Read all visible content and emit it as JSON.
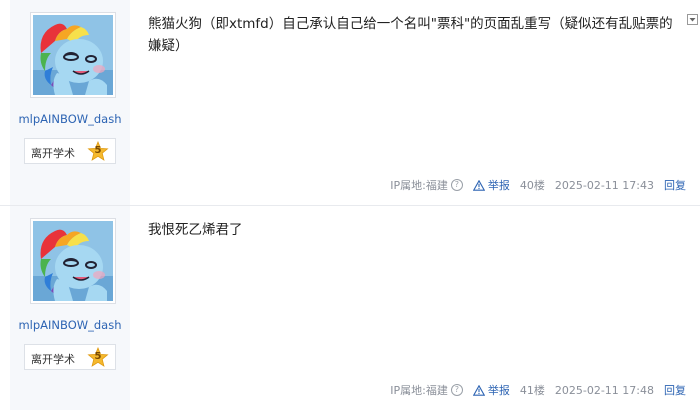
{
  "posts": [
    {
      "username": "mlpAINBOW_dash",
      "level_name": "离开学术",
      "level_num": "5",
      "content": "熊猫火狗（即xtmfd）自己承认自己给一个名叫\"票科\"的页面乱重写（疑似还有乱贴票的嫌疑）",
      "ip": "IP属地:福建",
      "help_glyph": "?",
      "report": "举报",
      "floor": "40楼",
      "time": "2025-02-11 17:43",
      "reply": "回复"
    },
    {
      "username": "mlpAINBOW_dash",
      "level_name": "离开学术",
      "level_num": "5",
      "content": "我恨死乙烯君了",
      "ip": "IP属地:福建",
      "help_glyph": "?",
      "report": "举报",
      "floor": "41楼",
      "time": "2025-02-11 17:48",
      "reply": "回复"
    }
  ],
  "colors": {
    "link": "#2d64b3",
    "meta": "#8a8f99",
    "sidebar_bg": "#f6f8fb",
    "level_star": "#f5b92e"
  },
  "icons": {
    "avatar": "rainbow-dash-pony-avatar",
    "level": "star-level-icon",
    "report": "warning-triangle-icon",
    "help": "question-circle-icon",
    "collapse": "chevron-down-icon"
  }
}
